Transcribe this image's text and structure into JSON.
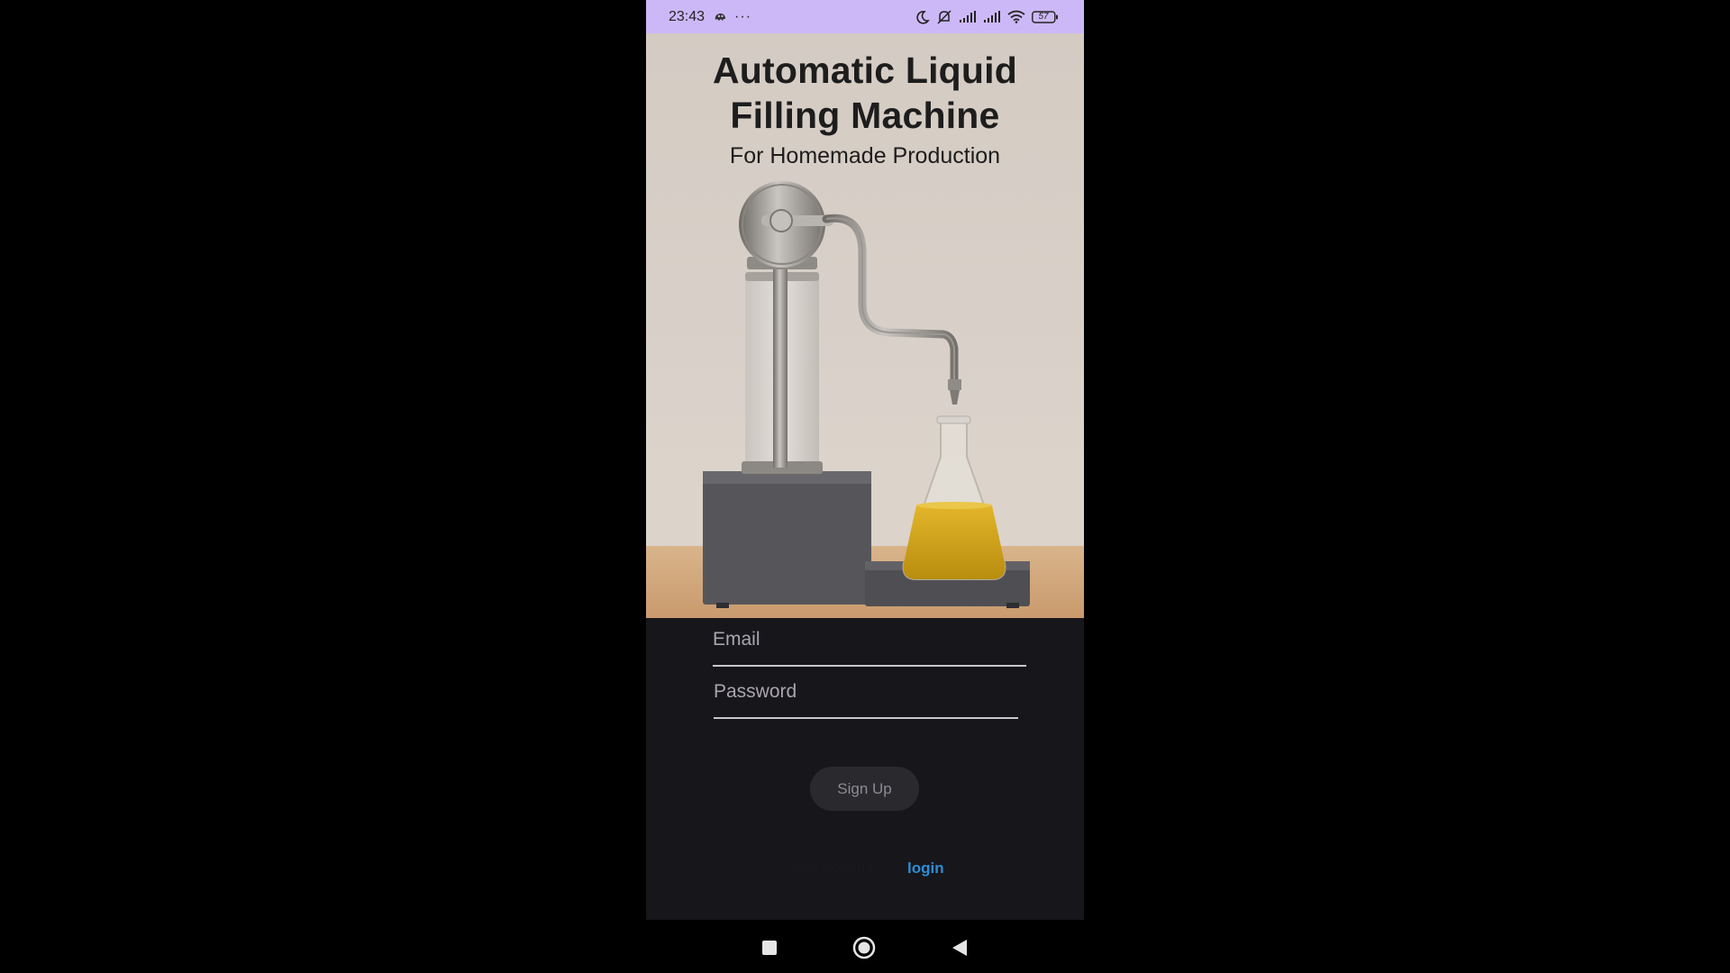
{
  "status_bar": {
    "time": "23:43",
    "more": "···",
    "battery": "57",
    "background": "#cdb8f7"
  },
  "hero": {
    "title_line1": "Automatic Liquid",
    "title_line2": "Filling Machine",
    "subtitle": "For Homemade Production"
  },
  "form": {
    "email_placeholder": "Email",
    "password_placeholder": "Password",
    "signup_label": "Sign Up",
    "have_account_text": "have account?",
    "login_link": "login"
  },
  "colors": {
    "form_background": "#17161b",
    "link": "#2d8fd6",
    "liquid": "#d6a418"
  },
  "nav": {
    "icons": [
      "recents-square-icon",
      "home-circle-icon",
      "back-triangle-icon"
    ]
  }
}
